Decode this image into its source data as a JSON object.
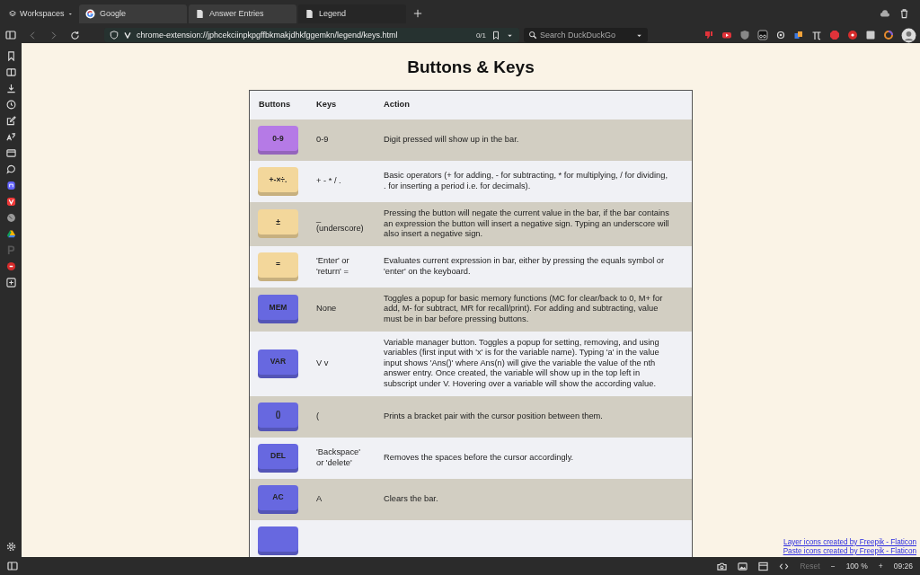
{
  "browser": {
    "workspaces": "Workspaces",
    "tabs": [
      {
        "title": "Google",
        "kind": "google",
        "selected": false
      },
      {
        "title": "Answer Entries",
        "kind": "page",
        "selected": false
      },
      {
        "title": "Legend",
        "kind": "page",
        "selected": true
      }
    ],
    "address": "chrome-extension://jphcekciinpkpgffbkmakjdhkfggemkn/legend/keys.html",
    "find_count": "0/1",
    "search": {
      "placeholder": "Search DuckDuckGo"
    }
  },
  "page": {
    "title": "Buttons & Keys",
    "columns": [
      "Buttons",
      "Keys",
      "Action"
    ],
    "rows": [
      {
        "button": "0-9",
        "color": "#b57ae6",
        "keys": "0-9",
        "action": "Digit pressed will show up in the bar."
      },
      {
        "button": "+-×÷.",
        "color": "#f3d79b",
        "keys": "+ - * / .",
        "action": "Basic operators (+ for adding, - for subtracting, * for multiplying, / for dividing, . for inserting a period i.e. for decimals)."
      },
      {
        "button": "±",
        "color": "#f3d79b",
        "keys": "_ (underscore)",
        "action": "Pressing the button will negate the current value in the bar, if the bar contains an expression the button will insert a negative sign. Typing an underscore will also insert a negative sign."
      },
      {
        "button": "=",
        "color": "#f3d79b",
        "keys": "'Enter' or 'return' =",
        "action": "Evaluates current expression in bar, either by pressing the equals symbol or 'enter' on the keyboard."
      },
      {
        "button": "MEM",
        "color": "#6768e0",
        "keys": "None",
        "action": "Toggles a popup for basic memory functions (MC for clear/back to 0, M+ for add, M- for subtract, MR for recall/print). For adding and subtracting, value must be in bar before pressing buttons."
      },
      {
        "button": "VAR",
        "color": "#6768e0",
        "keys": "V v",
        "action": "Variable manager button. Toggles a popup for setting, removing, and using variables (first input with 'x' is for the variable name). Typing 'a' in the value input shows 'Ans()' where Ans(n) will give the variable the value of the nth answer entry. Once created, the variable will show up in the top left in subscript under V. Hovering over a variable will show the according value."
      },
      {
        "button": "()",
        "color": "#6768e0",
        "keys": "(",
        "action": "Prints a bracket pair with the cursor position between them."
      },
      {
        "button": "DEL",
        "color": "#6768e0",
        "keys": "'Backspace' or 'delete'",
        "action": "Removes the spaces before the cursor accordingly."
      },
      {
        "button": "AC",
        "color": "#6768e0",
        "keys": "A",
        "action": "Clears the bar."
      },
      {
        "color": "#6768e0"
      }
    ],
    "credits": [
      "Layer icons created by Freepik - Flaticon",
      "Paste icons created by Freepik - Flaticon"
    ]
  },
  "status_bar": {
    "reset": "Reset",
    "zoom_out": "−",
    "zoom": "100 %",
    "zoom_in": "+",
    "time": "09:26"
  }
}
